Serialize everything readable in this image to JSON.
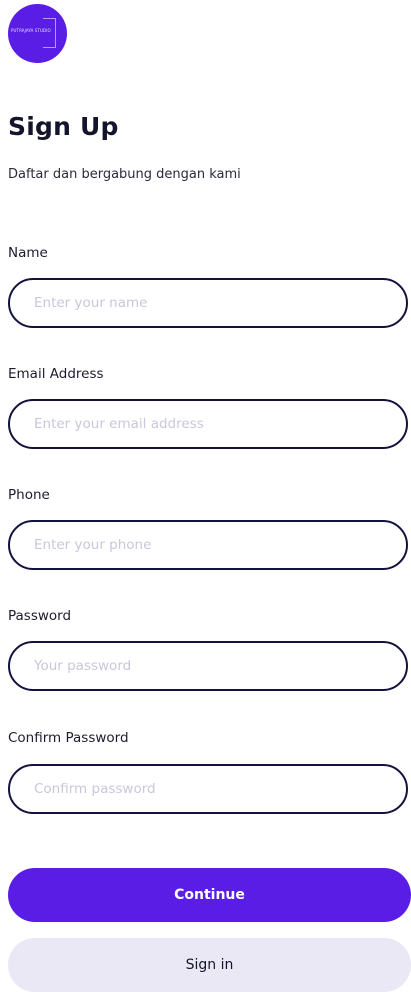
{
  "brand": {
    "logo_text": "PUTRAJAYA STUDIO",
    "accent_color": "#5a1de6",
    "field_border_color": "#14123d"
  },
  "header": {
    "title": "Sign Up",
    "subtitle": "Daftar dan bergabung dengan kami"
  },
  "form": {
    "name": {
      "label": "Name",
      "placeholder": "Enter your name",
      "value": ""
    },
    "email": {
      "label": "Email Address",
      "placeholder": "Enter your email address",
      "value": ""
    },
    "phone": {
      "label": "Phone",
      "placeholder": "Enter your phone",
      "value": ""
    },
    "password": {
      "label": "Password",
      "placeholder": "Your password",
      "value": ""
    },
    "confirm_password": {
      "label": "Confirm Password",
      "placeholder": "Confirm password",
      "value": ""
    }
  },
  "actions": {
    "continue_label": "Continue",
    "sign_in_label": "Sign in"
  }
}
